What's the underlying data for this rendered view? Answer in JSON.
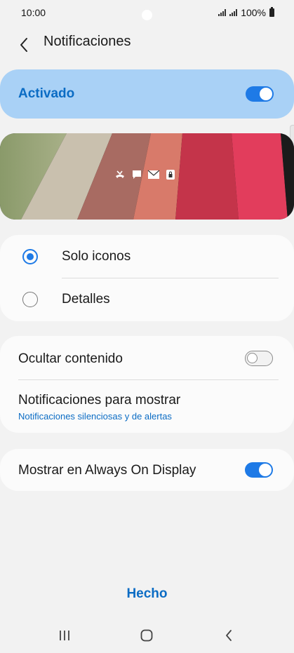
{
  "status_bar": {
    "time": "10:00",
    "battery": "100%"
  },
  "header": {
    "title": "Notificaciones",
    "back_icon": "chevron-left-icon"
  },
  "master": {
    "label": "Activado",
    "enabled": true
  },
  "preview": {
    "icons": [
      "missed-call-icon",
      "message-icon",
      "email-icon",
      "lock-icon"
    ]
  },
  "style_options": {
    "items": [
      {
        "label": "Solo iconos",
        "selected": true
      },
      {
        "label": "Detalles",
        "selected": false
      }
    ]
  },
  "content": {
    "hide_label": "Ocultar contenido",
    "hide_enabled": false,
    "show_label": "Notificaciones para mostrar",
    "show_value": "Notificaciones silenciosas y de alertas"
  },
  "aod": {
    "label": "Mostrar en Always On Display",
    "enabled": true
  },
  "footer": {
    "done_label": "Hecho"
  },
  "colors": {
    "accent": "#1e7ae6",
    "accent_text": "#0b6cc4",
    "master_bg": "#a9d1f6",
    "background": "#f2f2f2"
  }
}
